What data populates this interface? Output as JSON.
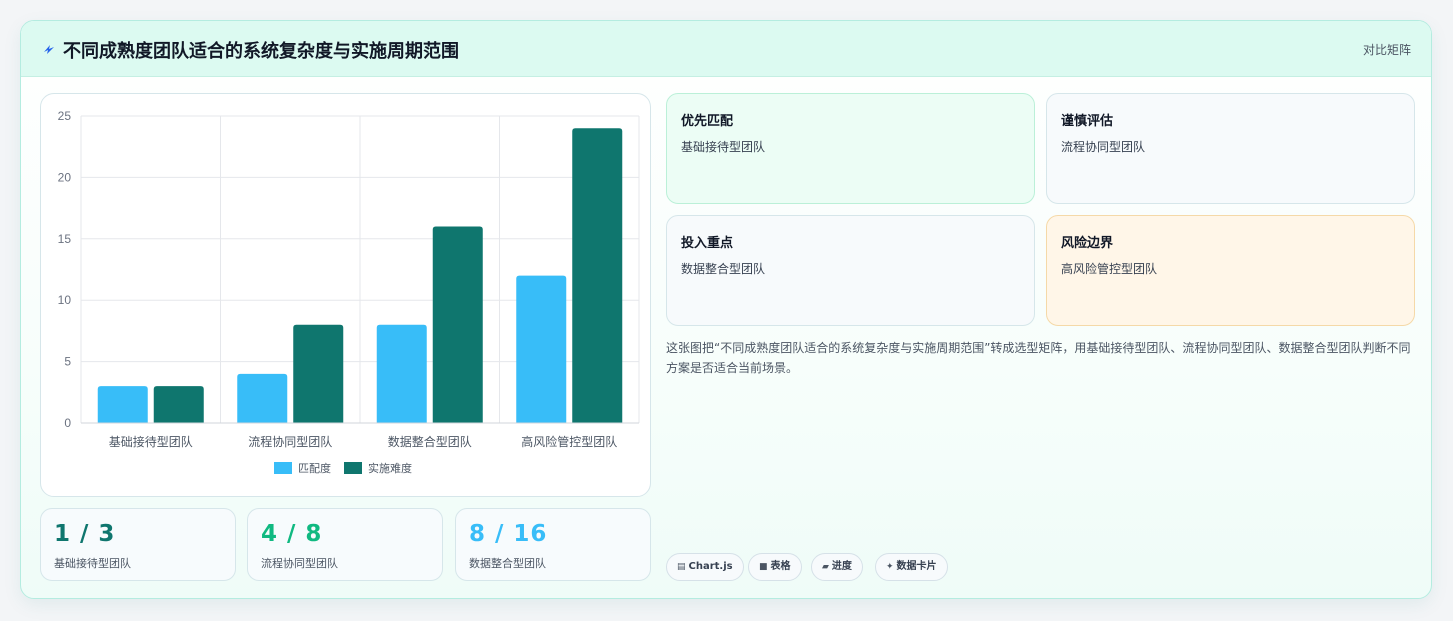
{
  "header": {
    "title": "不同成熟度团队适合的系统复杂度与实施周期范围",
    "right_label": "对比矩阵",
    "icon": "lightning-icon"
  },
  "chart_data": {
    "type": "bar",
    "categories": [
      "基础接待型团队",
      "流程协同型团队",
      "数据整合型团队",
      "高风险管控型团队"
    ],
    "series": [
      {
        "name": "匹配度",
        "values": [
          3,
          4,
          8,
          12
        ],
        "color": "#38bdf8"
      },
      {
        "name": "实施难度",
        "values": [
          3,
          8,
          16,
          24
        ],
        "color": "#0f766e"
      }
    ],
    "ylim": [
      0,
      25
    ],
    "yticks": [
      0,
      5,
      10,
      15,
      20,
      25
    ],
    "grid": true,
    "legend": "bottom"
  },
  "stats": [
    {
      "value": "1 / 3",
      "label": "基础接待型团队",
      "color": "#0f766e"
    },
    {
      "value": "4 / 8",
      "label": "流程协同型团队",
      "color": "#10b981"
    },
    {
      "value": "8 / 16",
      "label": "数据整合型团队",
      "color": "#38bdf8"
    }
  ],
  "tiles": [
    {
      "title": "优先匹配",
      "subtitle": "基础接待型团队",
      "bg": "#ecfdf5",
      "border": "#bbf0d8"
    },
    {
      "title": "谨慎评估",
      "subtitle": "流程协同型团队",
      "bg": "#f7fafc",
      "border": "#d6e6ea"
    },
    {
      "title": "投入重点",
      "subtitle": "数据整合型团队",
      "bg": "#f7fafc",
      "border": "#d6e6ea"
    },
    {
      "title": "风险边界",
      "subtitle": "高风险管控型团队",
      "bg": "#fff6e8",
      "border": "#f5d9a8"
    }
  ],
  "description": "这张图把“不同成熟度团队适合的系统复杂度与实施周期范围”转成选型矩阵，用基础接待型团队、流程协同型团队、数据整合型团队判断不同方案是否适合当前场景。",
  "chips": [
    {
      "icon": "chart-icon",
      "glyph": "▤",
      "label": "Chart.js"
    },
    {
      "icon": "table-icon",
      "glyph": "■",
      "label": "表格"
    },
    {
      "icon": "progress-icon",
      "glyph": "▰",
      "label": "进度"
    },
    {
      "icon": "sparkle-icon",
      "glyph": "✦",
      "label": "数据卡片"
    }
  ]
}
